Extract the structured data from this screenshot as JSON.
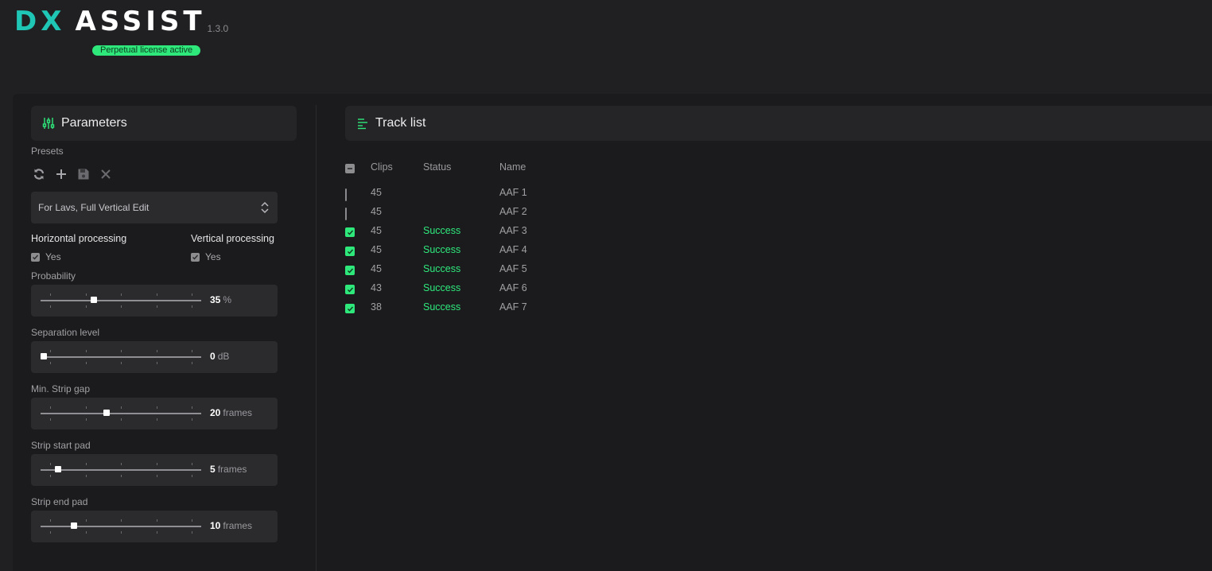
{
  "app": {
    "logo_dx": "DX",
    "logo_assist": "ASSIST",
    "version": "1.3.0",
    "license": "Perpetual license active",
    "accent": "#2ee87c",
    "logo_color": "#1fc6b5"
  },
  "parameters": {
    "title": "Parameters",
    "presets_label": "Presets",
    "preset_tools": [
      "refresh-icon",
      "plus-icon",
      "save-icon",
      "close-icon"
    ],
    "preset_selected": "For Lavs, Full Vertical Edit",
    "horizontal": {
      "title": "Horizontal processing",
      "checkbox_label": "Yes",
      "checked": true
    },
    "vertical": {
      "title": "Vertical processing",
      "checkbox_label": "Yes",
      "checked": true
    },
    "sliders": [
      {
        "label": "Probability",
        "value": "35",
        "unit": "%",
        "fraction": 0.33
      },
      {
        "label": "Separation level",
        "value": "0",
        "unit": "dB",
        "fraction": 0.02
      },
      {
        "label": "Min. Strip gap",
        "value": "20",
        "unit": "frames",
        "fraction": 0.41
      },
      {
        "label": "Strip start pad",
        "value": "5",
        "unit": "frames",
        "fraction": 0.11
      },
      {
        "label": "Strip end pad",
        "value": "10",
        "unit": "frames",
        "fraction": 0.21
      }
    ]
  },
  "tracklist": {
    "title": "Track list",
    "columns": [
      "Clips",
      "Status",
      "Name"
    ],
    "rows": [
      {
        "checked": false,
        "clips": "45",
        "status": "",
        "name": "AAF 1"
      },
      {
        "checked": false,
        "clips": "45",
        "status": "",
        "name": "AAF 2"
      },
      {
        "checked": true,
        "clips": "45",
        "status": "Success",
        "name": "AAF 3"
      },
      {
        "checked": true,
        "clips": "45",
        "status": "Success",
        "name": "AAF 4"
      },
      {
        "checked": true,
        "clips": "45",
        "status": "Success",
        "name": "AAF 5"
      },
      {
        "checked": true,
        "clips": "43",
        "status": "Success",
        "name": "AAF 6"
      },
      {
        "checked": true,
        "clips": "38",
        "status": "Success",
        "name": "AAF 7"
      }
    ]
  }
}
